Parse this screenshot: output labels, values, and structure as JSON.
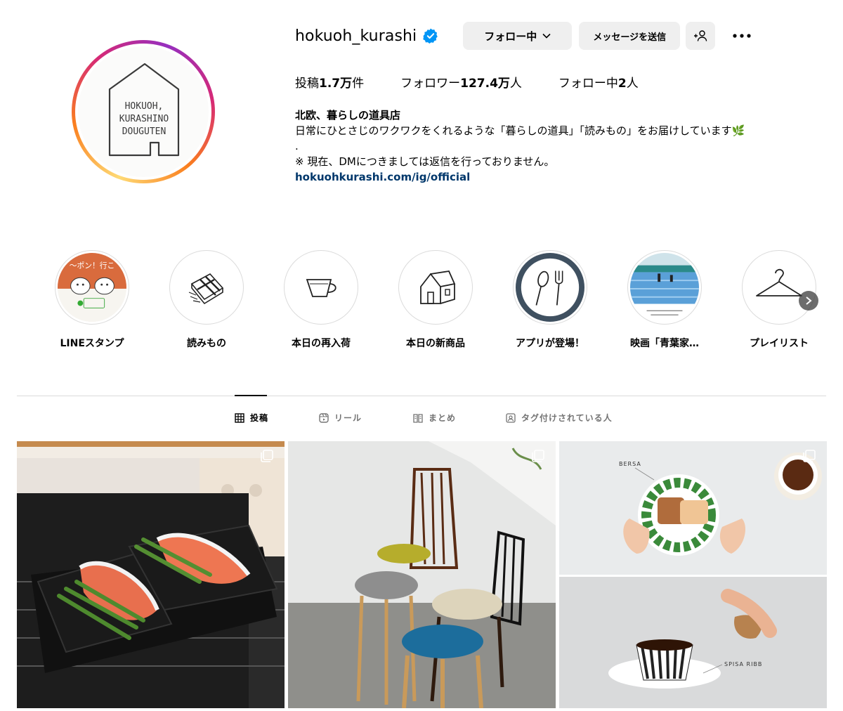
{
  "profile": {
    "username": "hokuoh_kurashi",
    "follow_button": "フォロー中",
    "message_button": "メッセージを送信",
    "add_user_icon": "person-add-icon",
    "more_icon": "more-horizontal-icon",
    "avatar_text": [
      "HOKUOH,",
      "KURASHINO",
      "DOUGUTEN"
    ]
  },
  "stats": {
    "posts_label": "投稿",
    "posts_value": "1.7万",
    "posts_suffix": "件",
    "followers_label": "フォロワー",
    "followers_value": "127.4万",
    "followers_suffix": "人",
    "following_label": "フォロー中",
    "following_value": "2",
    "following_suffix": "人"
  },
  "bio": {
    "name": "北欧、暮らしの道具店",
    "line1": "日常にひとさじのワクワクをくれるような「暮らしの道具」「読みもの」をお届けしています🌿",
    "line2": ".",
    "line3": "※ 現在、DMにつきましては返信を行っておりません。",
    "link": "hokuohkurashi.com/ig/official"
  },
  "highlights": [
    {
      "label": "LINEスタンプ",
      "icon": "line-sticker-cats"
    },
    {
      "label": "読みもの",
      "icon": "book-bundle-icon"
    },
    {
      "label": "本日の再入荷",
      "icon": "cup-icon"
    },
    {
      "label": "本日の新商品",
      "icon": "house-icon"
    },
    {
      "label": "アプリが登場！",
      "icon": "spoon-fork-icon"
    },
    {
      "label": "映画「青葉家…",
      "icon": "pool-scene"
    },
    {
      "label": "プレイリスト",
      "icon": "hanger-icon"
    }
  ],
  "tabs": [
    {
      "label": "投稿",
      "icon": "grid-icon",
      "active": true
    },
    {
      "label": "リール",
      "icon": "reels-icon",
      "active": false
    },
    {
      "label": "まとめ",
      "icon": "guide-icon",
      "active": false
    },
    {
      "label": "タグ付けされている人",
      "icon": "tagged-icon",
      "active": false
    }
  ],
  "posts": [
    {
      "subject": "salmon-oven-tray"
    },
    {
      "subject": "chairs-seat-cushions"
    },
    {
      "subject": "bersa-plate-coffee",
      "labels": [
        "BERSA",
        "SPISA RIBB"
      ]
    }
  ],
  "colors": {
    "link": "#00376b",
    "verified": "#0095f6",
    "button_bg": "#efefef",
    "divider": "#dbdbdb"
  }
}
